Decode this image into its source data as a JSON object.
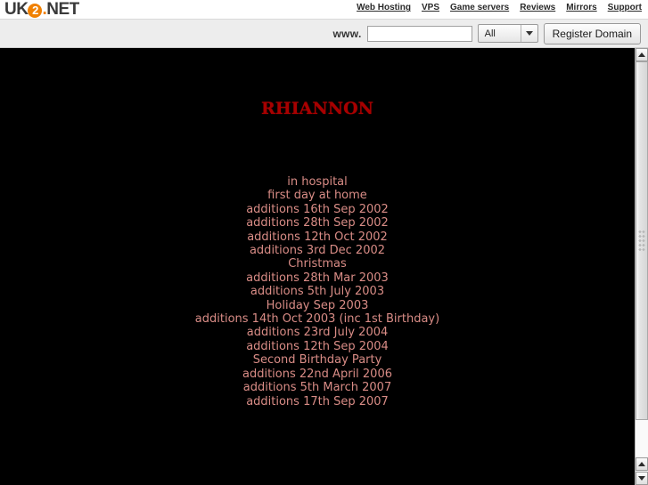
{
  "browser_chrome": {
    "uk2_header": {
      "logo": {
        "part_uk": "UK",
        "part_two": "2",
        "part_dot": ".",
        "part_net": "NET"
      },
      "nav_links": [
        {
          "label": "Web Hosting"
        },
        {
          "label": "VPS"
        },
        {
          "label": "Game servers"
        },
        {
          "label": "Reviews"
        },
        {
          "label": "Mirrors"
        },
        {
          "label": "Support"
        }
      ]
    },
    "toolbar": {
      "www_label": "www.",
      "domain_input_value": "",
      "domain_input_placeholder": "",
      "tld_selected": "All",
      "tld_options": [
        "All"
      ],
      "register_button_label": "Register Domain"
    },
    "scrollbar": {
      "scroll_up_icon": "triangle-up-icon",
      "scroll_down_icon": "triangle-down-icon",
      "thumb_grip_icon": "grip-dots-icon"
    }
  },
  "page": {
    "title_text": "rhiannon",
    "title_color": "#a80000",
    "background_color": "#000000",
    "link_color": "#d98c86",
    "links": [
      {
        "label": "in hospital"
      },
      {
        "label": "first day at home"
      },
      {
        "label": "additions 16th Sep 2002"
      },
      {
        "label": "additions 28th Sep 2002"
      },
      {
        "label": "additions 12th Oct 2002"
      },
      {
        "label": "additions 3rd Dec 2002"
      },
      {
        "label": "Christmas"
      },
      {
        "label": "additions 28th Mar 2003"
      },
      {
        "label": "additions 5th July 2003"
      },
      {
        "label": "Holiday Sep 2003"
      },
      {
        "label": "additions 14th Oct 2003 (inc 1st Birthday)"
      },
      {
        "label": "additions 23rd July 2004"
      },
      {
        "label": "additions 12th Sep 2004"
      },
      {
        "label": "Second Birthday Party"
      },
      {
        "label": "additions 22nd April 2006"
      },
      {
        "label": "additions 5th March 2007"
      },
      {
        "label": "additions 17th Sep 2007"
      }
    ]
  }
}
